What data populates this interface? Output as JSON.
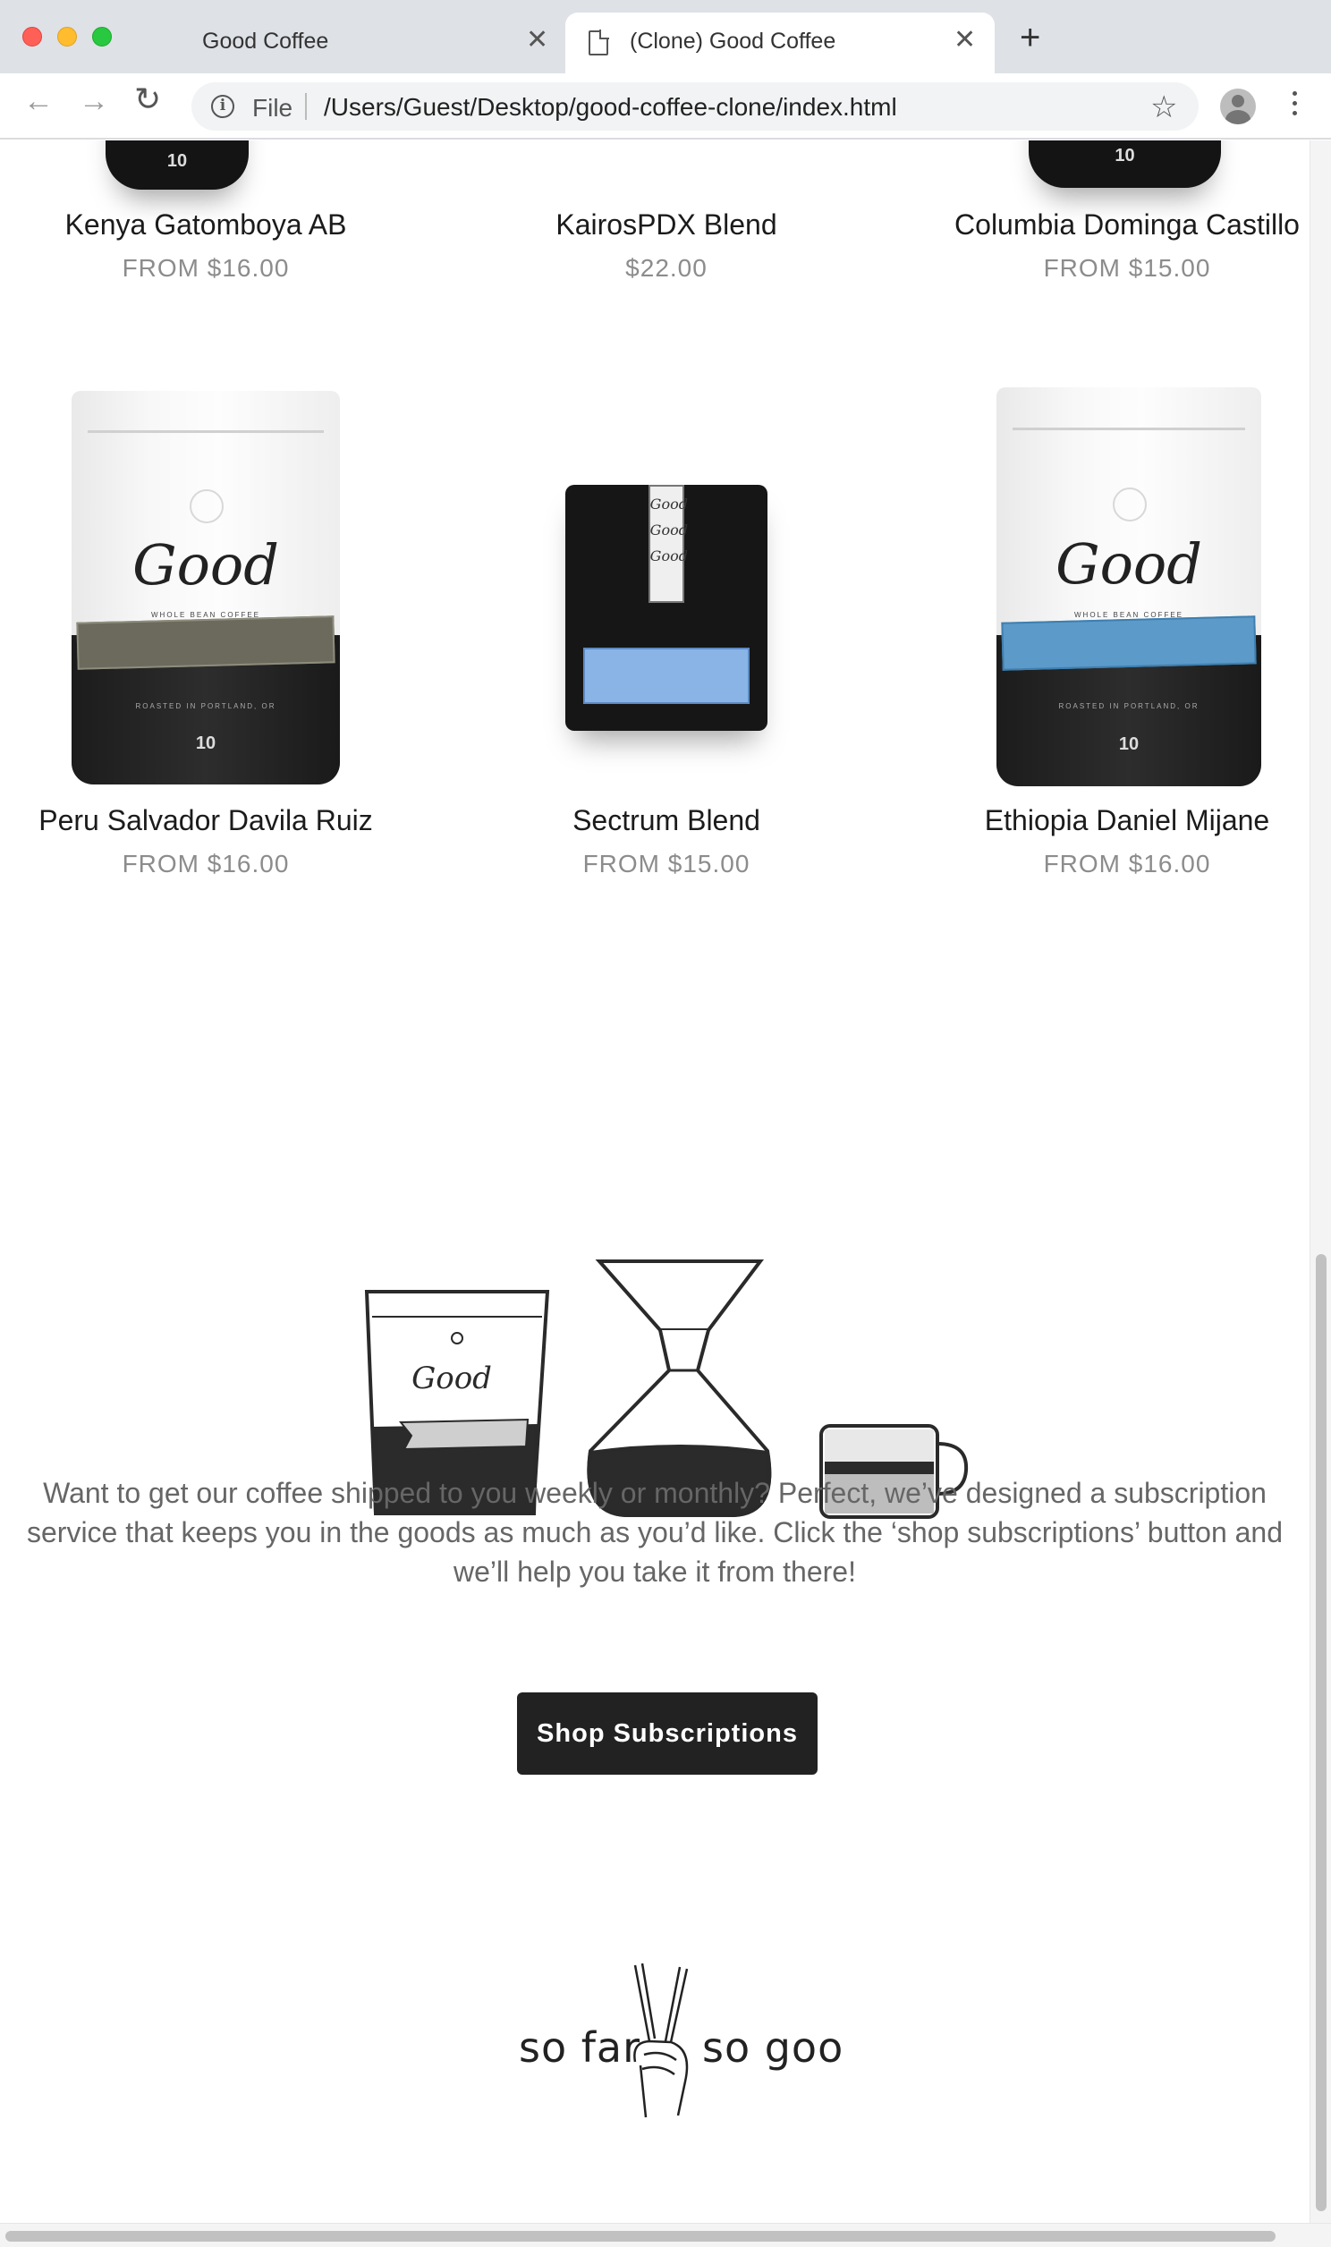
{
  "browser": {
    "tabs": [
      {
        "title": "Good Coffee",
        "active": false
      },
      {
        "title": "(Clone) Good Coffee",
        "active": true
      }
    ],
    "address": {
      "scheme": "File",
      "url": "/Users/Guest/Desktop/good-coffee-clone/index.html"
    },
    "icons": {
      "back": "arrow-left-icon",
      "forward": "arrow-right-icon",
      "reload": "reload-icon",
      "info": "info-icon",
      "bookmark": "star-icon",
      "profile": "avatar-icon",
      "menu": "kebab-menu-icon",
      "tab_close": "close-icon",
      "new_tab": "plus-icon"
    }
  },
  "products": {
    "row1": [
      {
        "name": "Kenya Gatomboya AB",
        "price": "FROM $16.00"
      },
      {
        "name": "KairosPDX Blend",
        "price": "$22.00"
      },
      {
        "name": "Columbia Dominga Castillo",
        "price": "FROM $15.00"
      }
    ],
    "row2": [
      {
        "name": "Peru Salvador Davila Ruiz",
        "price": "FROM $16.00"
      },
      {
        "name": "Sectrum Blend",
        "price": "FROM $15.00"
      },
      {
        "name": "Ethiopia Daniel Mijane",
        "price": "FROM $16.00"
      }
    ],
    "bag_logo": "Good",
    "bag_net_weight": "10"
  },
  "subscription": {
    "blurb": "Want to get our coffee shipped to you weekly or monthly? Perfect, we’ve designed a subscription service that keeps you in the goods as much as you’d like. Click the ‘shop subscriptions’ button and we’ll help you take it from there!",
    "button_label": "Shop Subscriptions",
    "illustration_bag_logo": "Good"
  },
  "footer": {
    "left_text": "so far",
    "right_text": "so good"
  },
  "colors": {
    "button_bg": "#222222",
    "price_text": "#8c8c8c",
    "blurb_text": "#666666",
    "label_brown": "#6b6a5c",
    "label_blue": "#5b9ac9",
    "spectrum_blue": "#8ab4e6"
  }
}
